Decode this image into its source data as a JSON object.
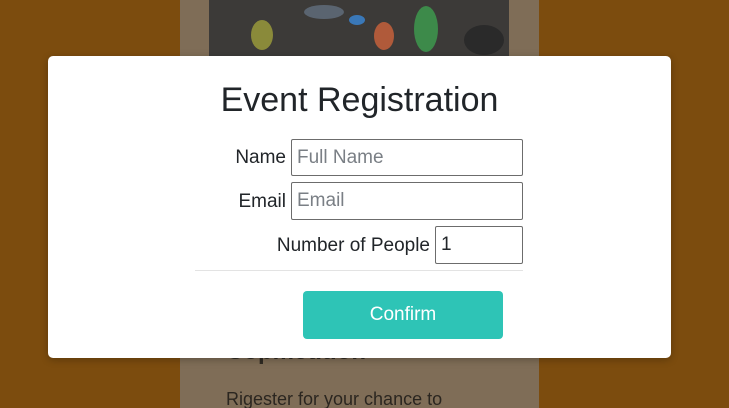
{
  "background": {
    "card_heading": "Copmetition",
    "card_text": "Rigester for your chance to"
  },
  "modal": {
    "title": "Event Registration",
    "fields": {
      "name": {
        "label": "Name",
        "placeholder": "Full Name",
        "value": ""
      },
      "email": {
        "label": "Email",
        "placeholder": "Email",
        "value": ""
      },
      "people": {
        "label": "Number of People",
        "value": "1"
      }
    },
    "confirm_label": "Confirm"
  },
  "colors": {
    "page_background": "#7c4c0e",
    "accent_button": "#2ec4b6",
    "modal_background": "#ffffff"
  }
}
